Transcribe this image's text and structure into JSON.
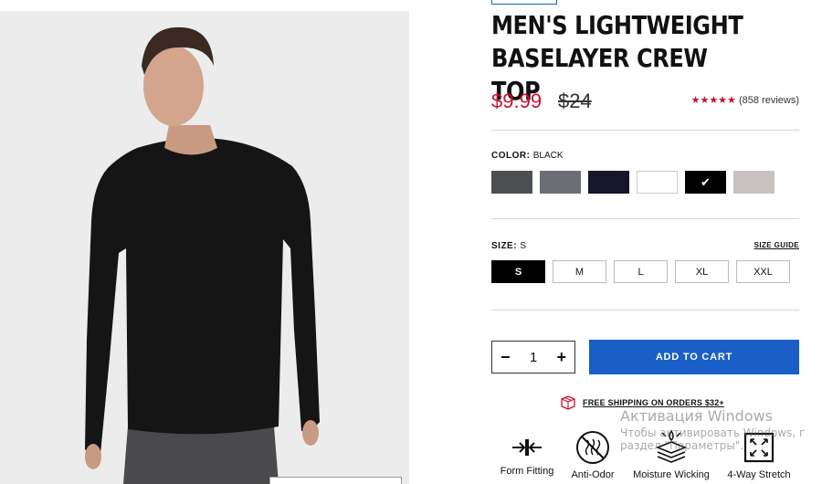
{
  "product": {
    "title_line1": "MEN'S LIGHTWEIGHT",
    "title_line2": "BASELAYER CREW TOP",
    "price_sale": "$9.99",
    "price_original": "$24",
    "rating_stars": "★★★★★",
    "reviews": "(858 reviews)"
  },
  "color": {
    "label": "COLOR:",
    "selected": "BLACK",
    "swatches": [
      {
        "name": "charcoal",
        "hex": "#4b4f52"
      },
      {
        "name": "gray",
        "hex": "#6b6e72"
      },
      {
        "name": "navy",
        "hex": "#15162a"
      },
      {
        "name": "white",
        "hex": "#ffffff"
      },
      {
        "name": "black",
        "hex": "#000000",
        "selected": true,
        "check": "✔"
      },
      {
        "name": "light-gray",
        "hex": "#c7c2c0"
      }
    ]
  },
  "size": {
    "label": "SIZE:",
    "selected": "S",
    "guide_label": "SIZE GUIDE",
    "options": [
      "S",
      "M",
      "L",
      "XL",
      "XXL"
    ]
  },
  "cart": {
    "minus": "−",
    "quantity": "1",
    "plus": "+",
    "add_label": "ADD TO CART"
  },
  "shipping": {
    "label": "FREE SHIPPING ON ORDERS $32+"
  },
  "features": [
    {
      "icon": "form-fitting-icon",
      "label": "Form Fitting"
    },
    {
      "icon": "anti-odor-icon",
      "label": "Anti-Odor"
    },
    {
      "icon": "moisture-wicking-icon",
      "label": "Moisture Wicking"
    },
    {
      "icon": "four-way-stretch-icon",
      "label": "4-Way Stretch"
    }
  ],
  "watermark": {
    "line1": "Активация Windows",
    "line2": "Чтобы активировать Windows, г",
    "line3": "раздел \"Параметры\"."
  },
  "colors": {
    "accent_blue": "#1a5fc7",
    "sale_red": "#c8102e"
  }
}
